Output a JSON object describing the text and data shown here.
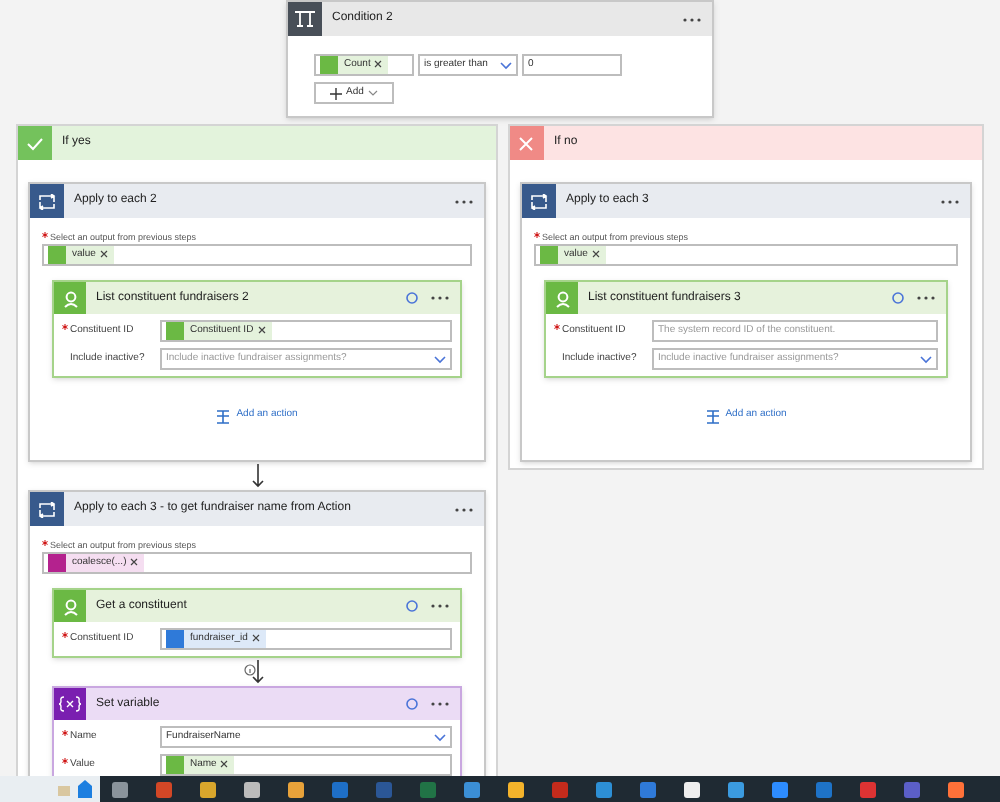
{
  "condition": {
    "title": "Condition 2",
    "operand": "Count",
    "operator": "is greater than",
    "value": "0",
    "add_label": "Add"
  },
  "branches": [
    {
      "kind": "yes",
      "title": "If yes",
      "steps": [
        {
          "kind": "loop",
          "title": "Apply to each 2",
          "select_label": "Select an output from previous steps",
          "token": {
            "kind": "connector",
            "text": "value"
          },
          "actions": [
            {
              "kind": "connector",
              "title": "List constituent fundraisers 2",
              "fields": [
                {
                  "kind": "token",
                  "label": "Constituent ID",
                  "required": true,
                  "token": {
                    "kind": "connector",
                    "text": "Constituent ID"
                  }
                },
                {
                  "kind": "dropdown",
                  "label": "Include inactive?",
                  "required": false,
                  "placeholder": "Include inactive fundraiser assignments?"
                }
              ]
            }
          ],
          "add_action": "Add an action"
        },
        {
          "kind": "loop",
          "title": "Apply to each 3 - to get fundraiser name from Action",
          "select_label": "Select an output from previous steps",
          "token": {
            "kind": "function",
            "text": "coalesce(...)"
          },
          "actions": [
            {
              "kind": "connector",
              "title": "Get a constituent",
              "fields": [
                {
                  "kind": "token",
                  "label": "Constituent ID",
                  "required": true,
                  "token": {
                    "kind": "dynamic",
                    "text": "fundraiser_id"
                  }
                }
              ]
            },
            {
              "kind": "variable",
              "title": "Set variable",
              "fields": [
                {
                  "kind": "dropdown",
                  "label": "Name",
                  "required": true,
                  "value": "FundraiserName"
                },
                {
                  "kind": "token",
                  "label": "Value",
                  "required": true,
                  "token": {
                    "kind": "connector",
                    "text": "Name"
                  }
                }
              ]
            }
          ]
        }
      ]
    },
    {
      "kind": "no",
      "title": "If no",
      "steps": [
        {
          "kind": "loop",
          "title": "Apply to each 3",
          "select_label": "Select an output from previous steps",
          "token": {
            "kind": "connector",
            "text": "value"
          },
          "actions": [
            {
              "kind": "connector",
              "title": "List constituent fundraisers 3",
              "fields": [
                {
                  "kind": "text",
                  "label": "Constituent ID",
                  "required": true,
                  "placeholder": "The system record ID of the constituent."
                },
                {
                  "kind": "dropdown",
                  "label": "Include inactive?",
                  "required": false,
                  "placeholder": "Include inactive fundraiser assignments?"
                }
              ]
            }
          ],
          "add_action": "Add an action"
        }
      ]
    }
  ]
}
